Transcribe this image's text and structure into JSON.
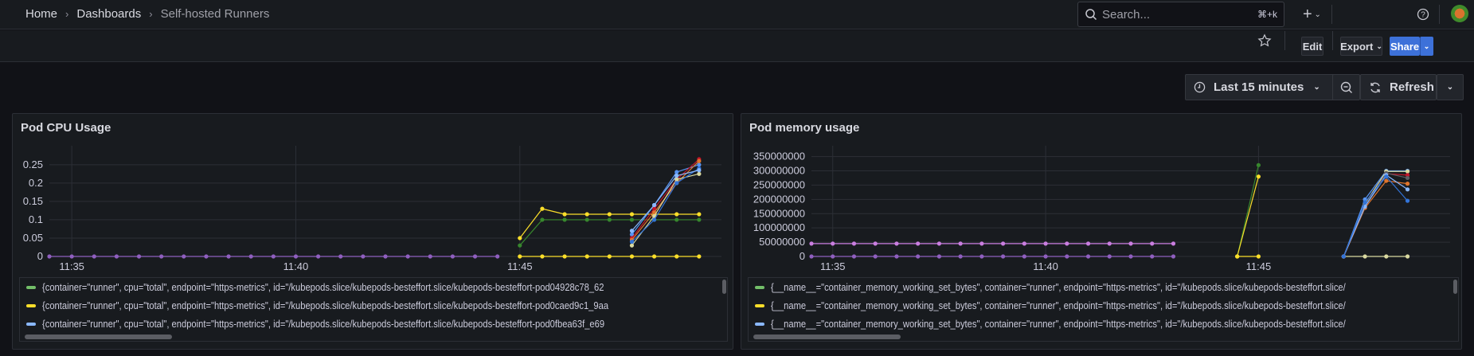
{
  "breadcrumb": {
    "home": "Home",
    "dashboards": "Dashboards",
    "current": "Self-hosted Runners"
  },
  "search": {
    "placeholder": "Search...",
    "shortcut": "⌘+k"
  },
  "toolbar": {
    "edit": "Edit",
    "export": "Export",
    "share": "Share"
  },
  "timepicker": {
    "range": "Last 15 minutes",
    "refresh": "Refresh"
  },
  "colors": {
    "accent": "#3d71d9",
    "background": "#111217",
    "panel": "#181b1f"
  },
  "chart_data": [
    {
      "id": "cpu",
      "type": "line",
      "title": "Pod CPU Usage",
      "ylim": [
        0,
        0.28
      ],
      "yticks": [
        "0",
        "0.05",
        "0.1",
        "0.15",
        "0.2",
        "0.25"
      ],
      "ytick_values": [
        0,
        0.05,
        0.1,
        0.15,
        0.2,
        0.25
      ],
      "xlim": [
        "11:34:30",
        "11:49:30"
      ],
      "xticks": [
        "11:35",
        "11:40",
        "11:45"
      ],
      "series": [
        {
          "name": "purple",
          "color": "#8f5fbf",
          "start": "11:34:30",
          "values": [
            0,
            0,
            0,
            0,
            0,
            0,
            0,
            0,
            0,
            0,
            0,
            0,
            0,
            0,
            0,
            0,
            0,
            0,
            0,
            0,
            0
          ]
        },
        {
          "name": "yellow-zero",
          "color": "#fade2a",
          "start": "11:45:00",
          "values": [
            0,
            0,
            0,
            0,
            0,
            0,
            0,
            0,
            0
          ]
        },
        {
          "name": "yellow",
          "color": "#fade2a",
          "start": "11:45:00",
          "values": [
            0.05,
            0.13,
            0.115,
            0.115,
            0.115,
            0.115,
            0.115,
            0.115,
            0.115
          ]
        },
        {
          "name": "green",
          "color": "#37872d",
          "start": "11:45:00",
          "values": [
            0.03,
            0.1,
            0.1,
            0.1,
            0.1,
            0.1,
            0.1,
            0.1,
            0.1
          ]
        },
        {
          "name": "blue",
          "color": "#5794f2",
          "start": "11:47:30",
          "values": [
            0.06,
            0.14,
            0.23,
            0.25
          ]
        },
        {
          "name": "red",
          "color": "#c4162a",
          "start": "11:47:30",
          "values": [
            0.05,
            0.13,
            0.21,
            0.265
          ]
        },
        {
          "name": "orange",
          "color": "#e0752d",
          "start": "11:47:30",
          "values": [
            0.045,
            0.12,
            0.2,
            0.26
          ]
        },
        {
          "name": "beige",
          "color": "#d9d9a0",
          "start": "11:47:30",
          "values": [
            0.03,
            0.11,
            0.21,
            0.225
          ]
        },
        {
          "name": "darkblue",
          "color": "#3274d9",
          "start": "11:47:30",
          "values": [
            0.04,
            0.1,
            0.2,
            0.24
          ]
        },
        {
          "name": "lightblue",
          "color": "#8ab8ff",
          "start": "11:47:30",
          "values": [
            0.07,
            0.14,
            0.22,
            0.235
          ]
        }
      ],
      "legend": [
        {
          "color": "#73bf69",
          "label": "{container=\"runner\", cpu=\"total\", endpoint=\"https-metrics\", id=\"/kubepods.slice/kubepods-besteffort.slice/kubepods-besteffort-pod04928c78_62"
        },
        {
          "color": "#fade2a",
          "label": "{container=\"runner\", cpu=\"total\", endpoint=\"https-metrics\", id=\"/kubepods.slice/kubepods-besteffort.slice/kubepods-besteffort-pod0caed9c1_9aa"
        },
        {
          "color": "#8ab8ff",
          "label": "{container=\"runner\", cpu=\"total\", endpoint=\"https-metrics\", id=\"/kubepods.slice/kubepods-besteffort.slice/kubepods-besteffort-pod0fbea63f_e69"
        }
      ]
    },
    {
      "id": "mem",
      "type": "line",
      "title": "Pod memory usage",
      "ylim": [
        0,
        360000000
      ],
      "yticks": [
        "0",
        "50000000",
        "100000000",
        "150000000",
        "200000000",
        "250000000",
        "300000000",
        "350000000"
      ],
      "ytick_values": [
        0,
        50000000,
        100000000,
        150000000,
        200000000,
        250000000,
        300000000,
        350000000
      ],
      "xlim": [
        "11:34:30",
        "11:49:30"
      ],
      "xticks": [
        "11:35",
        "11:40",
        "11:45"
      ],
      "series": [
        {
          "name": "light-purple",
          "color": "#ca7ee0",
          "start": "11:34:30",
          "values": [
            45000000,
            45000000,
            45000000,
            45000000,
            45000000,
            45000000,
            45000000,
            45000000,
            45000000,
            45000000,
            45000000,
            45000000,
            45000000,
            45000000,
            45000000,
            45000000,
            45000000,
            45000000
          ]
        },
        {
          "name": "purple",
          "color": "#8f5fbf",
          "start": "11:34:30",
          "values": [
            0,
            0,
            0,
            0,
            0,
            0,
            0,
            0,
            0,
            0,
            0,
            0,
            0,
            0,
            0,
            0,
            0,
            0
          ]
        },
        {
          "name": "green",
          "color": "#37872d",
          "start": "11:44:30",
          "values": [
            0,
            320000000
          ]
        },
        {
          "name": "yellow",
          "color": "#fade2a",
          "start": "11:44:30",
          "values": [
            0,
            280000000
          ]
        },
        {
          "name": "yellow-zero",
          "color": "#fade2a",
          "start": "11:44:30",
          "values": [
            0,
            0
          ]
        },
        {
          "name": "beige-zero",
          "color": "#d9d9a0",
          "start": "11:47:00",
          "values": [
            0,
            0,
            0,
            0
          ]
        },
        {
          "name": "blue",
          "color": "#5794f2",
          "start": "11:47:00",
          "values": [
            0,
            200000000,
            300000000,
            300000000
          ]
        },
        {
          "name": "beige",
          "color": "#d9d9a0",
          "start": "11:47:00",
          "values": [
            0,
            185000000,
            298000000,
            298000000
          ]
        },
        {
          "name": "darkred",
          "color": "#c4162a",
          "start": "11:47:00",
          "values": [
            0,
            175000000,
            290000000,
            285000000
          ]
        },
        {
          "name": "gray",
          "color": "#5b5d63",
          "start": "11:47:00",
          "values": [
            0,
            180000000,
            292000000,
            275000000
          ]
        },
        {
          "name": "orange",
          "color": "#e0752d",
          "start": "11:47:00",
          "values": [
            0,
            170000000,
            265000000,
            255000000
          ]
        },
        {
          "name": "lightblue",
          "color": "#8ab8ff",
          "start": "11:47:00",
          "values": [
            0,
            175000000,
            285000000,
            235000000
          ]
        },
        {
          "name": "darkblue",
          "color": "#3274d9",
          "start": "11:47:00",
          "values": [
            0,
            190000000,
            280000000,
            195000000
          ]
        }
      ],
      "legend": [
        {
          "color": "#73bf69",
          "label": "{__name__=\"container_memory_working_set_bytes\", container=\"runner\", endpoint=\"https-metrics\", id=\"/kubepods.slice/kubepods-besteffort.slice/"
        },
        {
          "color": "#fade2a",
          "label": "{__name__=\"container_memory_working_set_bytes\", container=\"runner\", endpoint=\"https-metrics\", id=\"/kubepods.slice/kubepods-besteffort.slice/"
        },
        {
          "color": "#8ab8ff",
          "label": "{__name__=\"container_memory_working_set_bytes\", container=\"runner\", endpoint=\"https-metrics\", id=\"/kubepods.slice/kubepods-besteffort.slice/"
        }
      ]
    }
  ]
}
